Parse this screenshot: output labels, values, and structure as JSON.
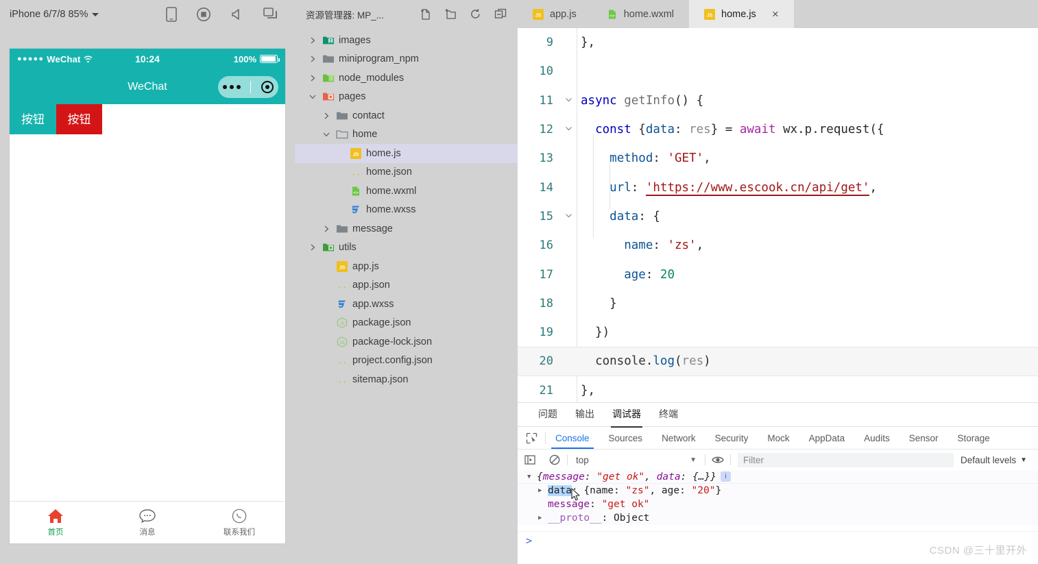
{
  "simulator": {
    "device_selector": "iPhone 6/7/8 85%",
    "toolbar_icons": [
      "device-icon",
      "record-icon",
      "volume-icon",
      "multi-window-icon"
    ],
    "status_bar": {
      "carrier": "WeChat",
      "dots": "●●●●●",
      "time": "10:24",
      "battery_percent": "100%"
    },
    "nav_title": "WeChat",
    "buttons": [
      {
        "label": "按钮",
        "style": "primary"
      },
      {
        "label": "按钮",
        "style": "warn"
      }
    ],
    "tabbar": [
      {
        "label": "首页",
        "icon": "home-icon",
        "active": true
      },
      {
        "label": "消息",
        "icon": "message-icon",
        "active": false
      },
      {
        "label": "联系我们",
        "icon": "phone-icon",
        "active": false
      }
    ]
  },
  "explorer": {
    "title": "资源管理器: MP_...",
    "header_icons": [
      "new-file-icon",
      "new-folder-icon",
      "refresh-icon",
      "collapse-all-icon"
    ],
    "tree": [
      {
        "label": "images",
        "type": "folder",
        "indent": 0,
        "expanded": false,
        "icon": "folder-images"
      },
      {
        "label": "miniprogram_npm",
        "type": "folder",
        "indent": 0,
        "expanded": false,
        "icon": "folder-plain"
      },
      {
        "label": "node_modules",
        "type": "folder",
        "indent": 0,
        "expanded": false,
        "icon": "folder-node"
      },
      {
        "label": "pages",
        "type": "folder",
        "indent": 0,
        "expanded": true,
        "icon": "folder-pages"
      },
      {
        "label": "contact",
        "type": "folder",
        "indent": 1,
        "expanded": false,
        "icon": "folder-plain"
      },
      {
        "label": "home",
        "type": "folder",
        "indent": 1,
        "expanded": true,
        "icon": "folder-open"
      },
      {
        "label": "home.js",
        "type": "file",
        "indent": 2,
        "icon": "js-icon",
        "selected": true
      },
      {
        "label": "home.json",
        "type": "file",
        "indent": 2,
        "icon": "json-icon"
      },
      {
        "label": "home.wxml",
        "type": "file",
        "indent": 2,
        "icon": "wxml-icon"
      },
      {
        "label": "home.wxss",
        "type": "file",
        "indent": 2,
        "icon": "wxss-icon"
      },
      {
        "label": "message",
        "type": "folder",
        "indent": 1,
        "expanded": false,
        "icon": "folder-plain"
      },
      {
        "label": "utils",
        "type": "folder",
        "indent": 0,
        "expanded": false,
        "icon": "folder-utils"
      },
      {
        "label": "app.js",
        "type": "file",
        "indent": 1,
        "icon": "js-icon"
      },
      {
        "label": "app.json",
        "type": "file",
        "indent": 1,
        "icon": "json-icon"
      },
      {
        "label": "app.wxss",
        "type": "file",
        "indent": 1,
        "icon": "wxss-icon"
      },
      {
        "label": "package.json",
        "type": "file",
        "indent": 1,
        "icon": "npm-icon"
      },
      {
        "label": "package-lock.json",
        "type": "file",
        "indent": 1,
        "icon": "npm-icon"
      },
      {
        "label": "project.config.json",
        "type": "file",
        "indent": 1,
        "icon": "json-icon"
      },
      {
        "label": "sitemap.json",
        "type": "file",
        "indent": 1,
        "icon": "json-icon"
      }
    ]
  },
  "editor": {
    "tabs": [
      {
        "label": "app.js",
        "icon": "js-icon",
        "active": false,
        "closable": false
      },
      {
        "label": "home.wxml",
        "icon": "wxml-icon",
        "active": false,
        "closable": false
      },
      {
        "label": "home.js",
        "icon": "js-icon",
        "active": true,
        "closable": true,
        "close_glyph": "×"
      }
    ],
    "code_lines": [
      {
        "num": "9",
        "fold": "",
        "text": "},",
        "highlight": false
      },
      {
        "num": "10",
        "fold": "",
        "text": "",
        "highlight": false
      },
      {
        "num": "11",
        "fold": "v",
        "text": "async getInfo() {",
        "highlight": false
      },
      {
        "num": "12",
        "fold": "v",
        "text": "  const {data: res} = await wx.p.request({",
        "highlight": false
      },
      {
        "num": "13",
        "fold": "",
        "text": "    method: 'GET',",
        "highlight": false
      },
      {
        "num": "14",
        "fold": "",
        "text": "    url: 'https://www.escook.cn/api/get',",
        "highlight": false
      },
      {
        "num": "15",
        "fold": "v",
        "text": "    data: {",
        "highlight": false
      },
      {
        "num": "16",
        "fold": "",
        "text": "      name: 'zs',",
        "highlight": false
      },
      {
        "num": "17",
        "fold": "",
        "text": "      age: 20",
        "highlight": false
      },
      {
        "num": "18",
        "fold": "",
        "text": "    }",
        "highlight": false
      },
      {
        "num": "19",
        "fold": "",
        "text": "  })",
        "highlight": false
      },
      {
        "num": "20",
        "fold": "",
        "text": "  console.log(res)",
        "highlight": true
      },
      {
        "num": "21",
        "fold": "",
        "text": "},",
        "highlight": false
      }
    ]
  },
  "panel": {
    "tabs": [
      {
        "label": "问题",
        "active": false
      },
      {
        "label": "输出",
        "active": false
      },
      {
        "label": "调试器",
        "active": true
      },
      {
        "label": "终端",
        "active": false
      }
    ]
  },
  "devtools": {
    "inspect_icon": "inspect-element-icon",
    "tabs": [
      {
        "label": "Console",
        "active": true
      },
      {
        "label": "Sources",
        "active": false
      },
      {
        "label": "Network",
        "active": false
      },
      {
        "label": "Security",
        "active": false
      },
      {
        "label": "Mock",
        "active": false
      },
      {
        "label": "AppData",
        "active": false
      },
      {
        "label": "Audits",
        "active": false
      },
      {
        "label": "Sensor",
        "active": false
      },
      {
        "label": "Storage",
        "active": false
      }
    ],
    "toolbar": {
      "sidebar_icon": "show-console-sidebar-icon",
      "clear_icon": "clear-console-icon",
      "context": "top",
      "eye_icon": "live-expression-icon",
      "filter_placeholder": "Filter",
      "levels": "Default levels"
    },
    "console": {
      "rows": [
        {
          "indent": 0,
          "triangle": "▼",
          "text": "{message: \"get ok\", data: {…}}",
          "badge": "i"
        },
        {
          "indent": 1,
          "triangle": "▶",
          "key": "data",
          "text": ": {name: \"zs\", age: \"20\"}"
        },
        {
          "indent": 1,
          "triangle": "",
          "key": "message",
          "text": ": \"get ok\""
        },
        {
          "indent": 1,
          "triangle": "▶",
          "key": "__proto__",
          "text": ": Object"
        }
      ],
      "prompt": ">"
    }
  },
  "watermark": "CSDN @三十里开外",
  "colors": {
    "wechat_teal": "#16b3ae",
    "warn_red": "#d41515",
    "tab_active_green": "#18a058",
    "devtools_blue": "#1a73e8",
    "selected_file_bg": "#d8d8ea"
  }
}
